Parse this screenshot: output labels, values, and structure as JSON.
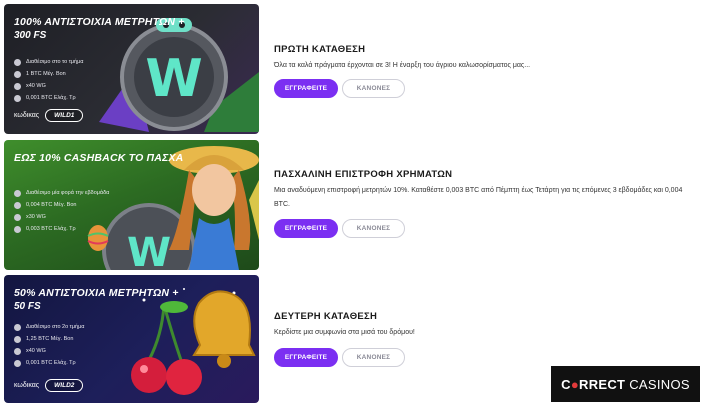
{
  "promotions": [
    {
      "banner": {
        "title": "100% ΑΝΤΙΣΤΟΙΧΙΑ ΜΕΤΡΗΤΩΝ +",
        "subtitle": "300 FS",
        "details": [
          "Διαθέσιμο στο το τμήμα",
          "1 BTC Μέγ. Bon",
          "x40 WG",
          "0,001 BTC Ελάχ. Τρ"
        ],
        "code_label": "κωδικας",
        "code": "WILD1"
      },
      "heading": "ΠΡΩΤΗ ΚΑΤΑΘΕΣΗ",
      "description": "Όλα τα καλά πράγματα έρχονται σε 3! Η έναρξη του άγριου καλωσορίσματος μας...",
      "primary_button": "ΕΓΓΡΑΦΕΙΤΕ",
      "secondary_button": "ΚΑΝΟΝΕΣ"
    },
    {
      "banner": {
        "title": "ΕΩΣ 10% CASHBACK ΤΟ ΠΑΣΧΑ",
        "subtitle": "",
        "details": [
          "Διαθέσιμο μία φορά την εβδομάδα",
          "0,004 BTC Μέγ. Bon",
          "x30 WG",
          "0,003 BTC Ελάχ. Τρ"
        ],
        "code_label": "",
        "code": ""
      },
      "heading": "ΠΑΣΧΑΛΙΝΗ ΕΠΙΣΤΡΟΦΗ ΧΡΗΜΑΤΩΝ",
      "description": "Μια αναδυόμενη επιστροφή μετρητών 10%. Καταθέστε 0,003 BTC από Πέμπτη έως Τετάρτη για τις επόμενες 3 εβδομάδες και 0,004 BTC.",
      "primary_button": "ΕΓΓΡΑΦΕΙΤΕ",
      "secondary_button": "ΚΑΝΟΝΕΣ"
    },
    {
      "banner": {
        "title": "50% ΑΝΤΙΣΤΟΙΧΙΑ ΜΕΤΡΗΤΩΝ +",
        "subtitle": "50 FS",
        "details": [
          "Διαθέσιμο στο 2ο τμήμα",
          "1,25 BTC Μέγ. Bon",
          "x40 WG",
          "0,001 BTC Ελάχ. Τρ"
        ],
        "code_label": "κωδικας",
        "code": "WILD2"
      },
      "heading": "ΔΕΥΤΕΡΗ ΚΑΤΑΘΕΣΗ",
      "description": "Κερδίστε μια συμφωνία στα μισά του δρόμου!",
      "primary_button": "ΕΓΓΡΑΦΕΙΤΕ",
      "secondary_button": "ΚΑΝΟΝΕΣ"
    }
  ],
  "watermark": {
    "part1": "C",
    "part2": "RRECT",
    "part3": "CASINOS"
  },
  "colors": {
    "accent": "#7b2ff2",
    "banner_dark": "#1e1f25",
    "banner_green": "#2c6b22",
    "banner_navy": "#131640"
  }
}
